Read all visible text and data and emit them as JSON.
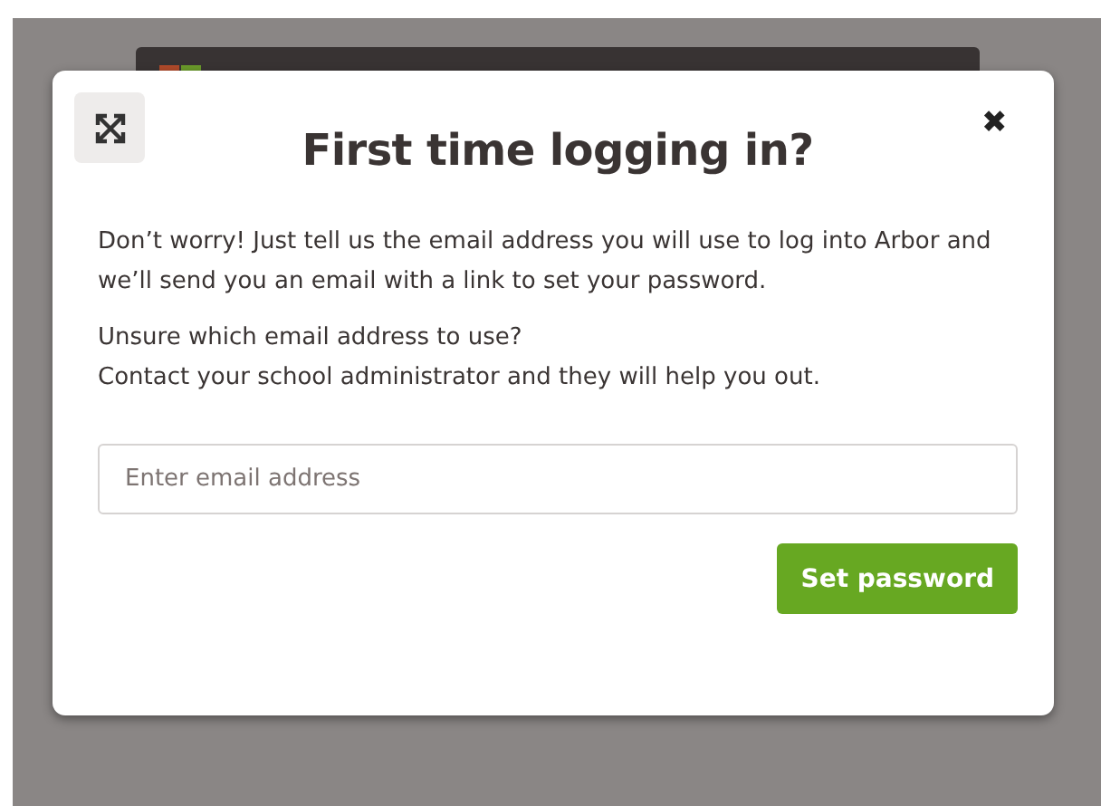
{
  "dialog": {
    "title": "First time logging in?",
    "close_label": "✖",
    "paragraphs": [
      "Don’t worry! Just tell us the email address you will use to log into Arbor and we’ll send you an email with a link to set your password.",
      "Unsure which email address to use?\nContact your school administrator and they will help you out."
    ],
    "email_field": {
      "placeholder": "Enter email address"
    },
    "submit_button": "Set password"
  }
}
